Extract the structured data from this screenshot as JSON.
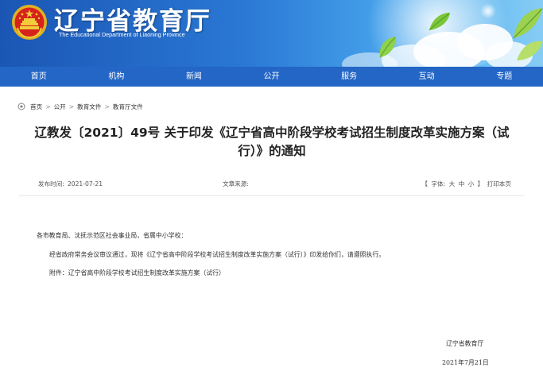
{
  "site": {
    "title": "辽宁省教育厅",
    "subtitle": "The Educational Department of Liaoning Province"
  },
  "nav": {
    "items": [
      {
        "label": "首页"
      },
      {
        "label": "机构"
      },
      {
        "label": "新闻"
      },
      {
        "label": "公开"
      },
      {
        "label": "服务"
      },
      {
        "label": "互动"
      },
      {
        "label": "专题"
      }
    ]
  },
  "breadcrumb": {
    "items": [
      {
        "label": "首页"
      },
      {
        "label": "公开"
      },
      {
        "label": "教育文件"
      },
      {
        "label": "教育厅文件"
      }
    ],
    "separator": ">"
  },
  "article": {
    "title_line1": "辽教发〔2021〕49号 关于印发《辽宁省高中阶段学校考试招生制度改革实施方案（试",
    "title_line2": "行）》的通知",
    "meta": {
      "date_label": "发布时间:",
      "date": "2021-07-21",
      "source_label": "文章来源:",
      "font_open": "【",
      "font_label": "字体:",
      "font_large": "大",
      "font_medium": "中",
      "font_small": "小",
      "font_close": "】",
      "print_label": "打印本页"
    },
    "body": {
      "salutation": "各市教育局、沈抚示范区社会事业局，省属中小学校：",
      "paragraph1": "经省政府常务会议审议通过，现将《辽宁省高中阶段学校考试招生制度改革实施方案（试行）》印发给你们，请遵照执行。",
      "paragraph2": "附件：辽宁省高中阶段学校考试招生制度改革实施方案（试行）",
      "signer": "辽宁省教育厅",
      "sign_date": "2021年7月21日"
    }
  },
  "colors": {
    "nav_background": "#2366c6",
    "banner_dark": "#1b56b4",
    "banner_light": "#86cdf5"
  }
}
